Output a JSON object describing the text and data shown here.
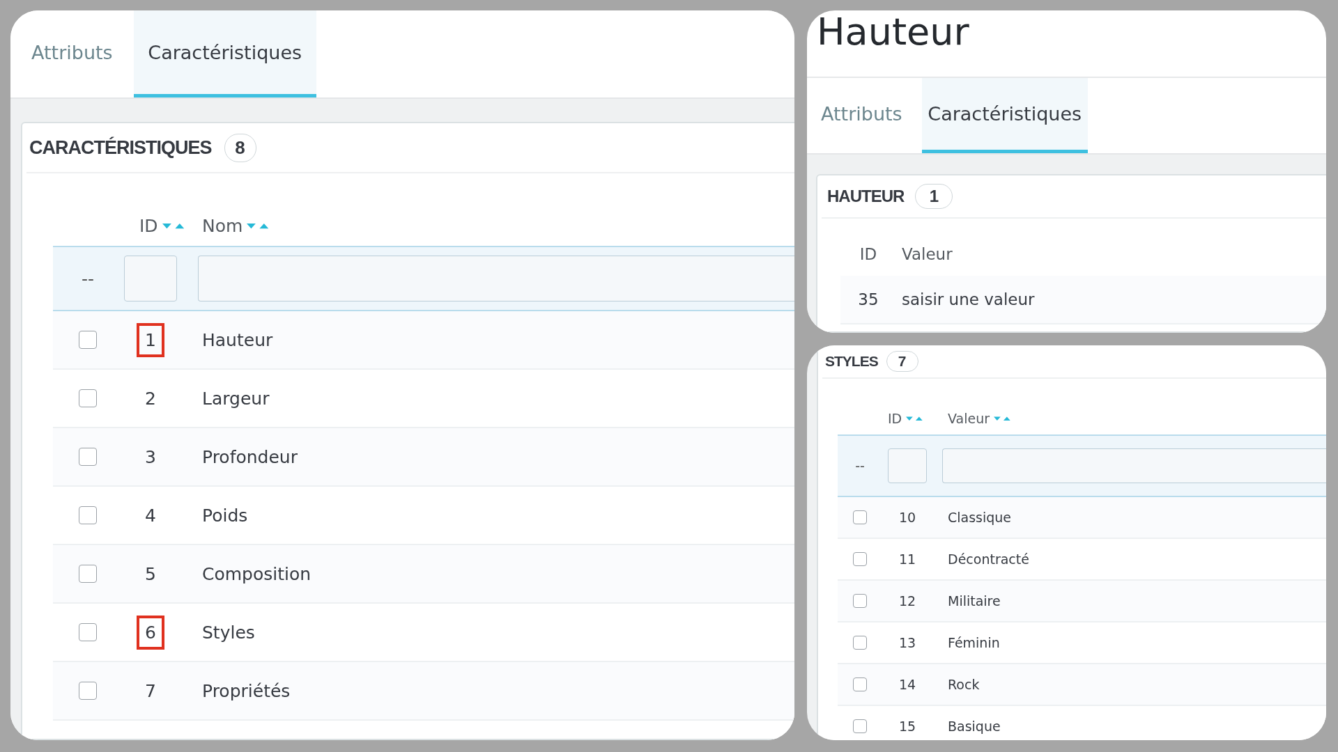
{
  "panels": [
    {
      "kind": "features",
      "tabs": [
        {
          "label": "Attributs",
          "selected": false
        },
        {
          "label": "Caractéristiques",
          "selected": true
        }
      ],
      "card": {
        "title": "CARACTÉRISTIQUES",
        "count": "8"
      },
      "columns": [
        {
          "label": "ID",
          "sortable": true
        },
        {
          "label": "Nom",
          "sortable": true
        }
      ],
      "filter": {
        "dash": "--"
      },
      "rows": [
        {
          "id": "1",
          "name": "Hauteur",
          "checked": false,
          "highlighted": true
        },
        {
          "id": "2",
          "name": "Largeur",
          "checked": false,
          "highlighted": false
        },
        {
          "id": "3",
          "name": "Profondeur",
          "checked": false,
          "highlighted": false
        },
        {
          "id": "4",
          "name": "Poids",
          "checked": false,
          "highlighted": false
        },
        {
          "id": "5",
          "name": "Composition",
          "checked": false,
          "highlighted": false
        },
        {
          "id": "6",
          "name": "Styles",
          "checked": false,
          "highlighted": true
        },
        {
          "id": "7",
          "name": "Propriétés",
          "checked": false,
          "highlighted": false
        }
      ]
    },
    {
      "kind": "values",
      "title": "Hauteur",
      "tabs": [
        {
          "label": "Attributs",
          "selected": false
        },
        {
          "label": "Caractéristiques",
          "selected": true
        }
      ],
      "card": {
        "title": "HAUTEUR",
        "count": "1"
      },
      "columns": [
        {
          "label": "ID",
          "sortable": false
        },
        {
          "label": "Valeur",
          "sortable": false
        }
      ],
      "rows": [
        {
          "id": "35",
          "name": "saisir une valeur"
        }
      ]
    },
    {
      "kind": "list",
      "card": {
        "title": "STYLES",
        "count": "7"
      },
      "columns": [
        {
          "label": "ID",
          "sortable": true
        },
        {
          "label": "Valeur",
          "sortable": true
        }
      ],
      "filter": {
        "dash": "--"
      },
      "rows": [
        {
          "id": "10",
          "name": "Classique",
          "checked": false
        },
        {
          "id": "11",
          "name": "Décontracté",
          "checked": false
        },
        {
          "id": "12",
          "name": "Militaire",
          "checked": false
        },
        {
          "id": "13",
          "name": "Féminin",
          "checked": false
        },
        {
          "id": "14",
          "name": "Rock",
          "checked": false
        },
        {
          "id": "15",
          "name": "Basique",
          "checked": false
        }
      ]
    }
  ]
}
